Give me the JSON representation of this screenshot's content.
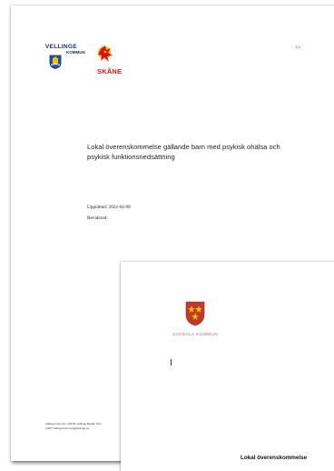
{
  "page1": {
    "logo_vellinge": {
      "name": "VELLINGE",
      "sub": "KOMMUN"
    },
    "logo_skane": {
      "name": "SKÅNE"
    },
    "page_number": "1 (r",
    "title": "Lokal överenskommelse gällande barn med psykisk ohälsa och psykisk funktionsnedsättning",
    "established": "Upprättad: 2022-04-08",
    "revised": "Reviderad:",
    "footer_line1": "Vellinge kommun, 235 81 Vellinge Besök: Norr",
    "footer_line2": "nr207 vellinge.kommun@vellinge.se"
  },
  "page2": {
    "logo_svedala": {
      "name": "SVEDALA KOMMUN"
    },
    "title_partial": "Lokal överenskommelse"
  },
  "colors": {
    "vellinge_blue": "#1f2a6b",
    "skane_red": "#d4161b",
    "skane_yellow": "#f4c300",
    "svedala_red": "#c0392b"
  }
}
